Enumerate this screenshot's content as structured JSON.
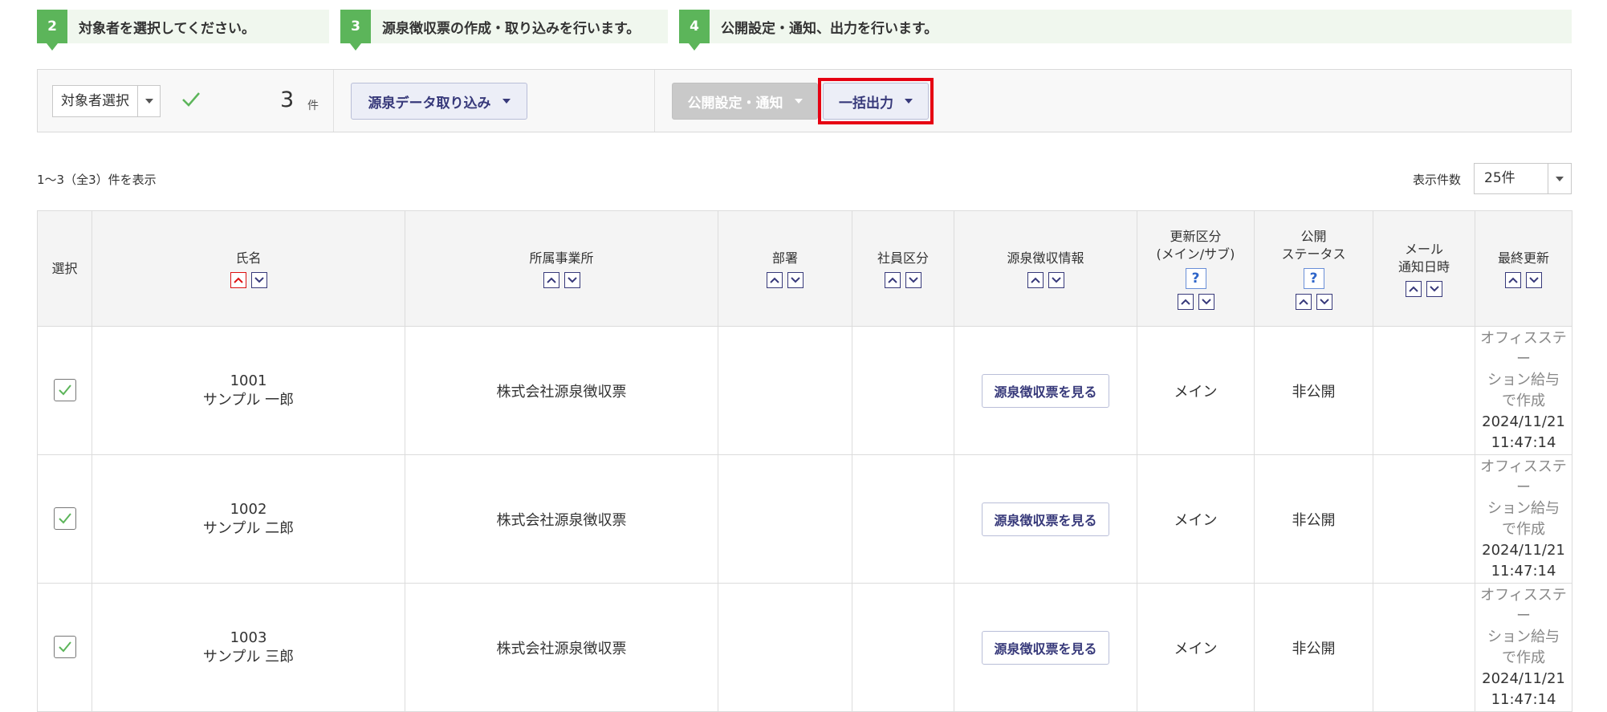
{
  "steps": [
    {
      "num": "2",
      "text": "対象者を選択してください。"
    },
    {
      "num": "3",
      "text": "源泉徴収票の作成・取り込みを行います。"
    },
    {
      "num": "4",
      "text": "公開設定・通知、出力を行います。"
    }
  ],
  "toolbar": {
    "select_label": "対象者選択",
    "count": "3",
    "count_unit": "件",
    "import_label": "源泉データ取り込み",
    "publish_label": "公開設定・通知",
    "bulk_label": "一括出力"
  },
  "info": {
    "range": "1〜3（全3）件を表示",
    "per_page_label": "表示件数",
    "per_page_value": "25件"
  },
  "table": {
    "headers": {
      "select": "選択",
      "name": "氏名",
      "office": "所属事業所",
      "dept": "部署",
      "emp_type": "社員区分",
      "withholding": "源泉徴収情報",
      "update_type_1": "更新区分",
      "update_type_2": "(メイン/サブ)",
      "status_1": "公開",
      "status_2": "ステータス",
      "mail_1": "メール",
      "mail_2": "通知日時",
      "last_update": "最終更新",
      "help": "?"
    },
    "rows": [
      {
        "id": "1001",
        "name": "サンプル 一郎",
        "office": "株式会社源泉徴収票",
        "dept": "",
        "emp_type": "",
        "view": "源泉徴収票を見る",
        "update_type": "メイン",
        "status": "非公開",
        "mail": "",
        "upd_src_1": "オフィスステー",
        "upd_src_2": "ション給与",
        "upd_src_3": "で作成",
        "upd_date": "2024/11/21",
        "upd_time": "11:47:14"
      },
      {
        "id": "1002",
        "name": "サンプル 二郎",
        "office": "株式会社源泉徴収票",
        "dept": "",
        "emp_type": "",
        "view": "源泉徴収票を見る",
        "update_type": "メイン",
        "status": "非公開",
        "mail": "",
        "upd_src_1": "オフィスステー",
        "upd_src_2": "ション給与",
        "upd_src_3": "で作成",
        "upd_date": "2024/11/21",
        "upd_time": "11:47:14"
      },
      {
        "id": "1003",
        "name": "サンプル 三郎",
        "office": "株式会社源泉徴収票",
        "dept": "",
        "emp_type": "",
        "view": "源泉徴収票を見る",
        "update_type": "メイン",
        "status": "非公開",
        "mail": "",
        "upd_src_1": "オフィスステー",
        "upd_src_2": "ション給与",
        "upd_src_3": "で作成",
        "upd_date": "2024/11/21",
        "upd_time": "11:47:14"
      }
    ]
  },
  "colors": {
    "step_green": "#5cb55a",
    "step_bg": "#f0f7ee",
    "accent_navy": "#37397a",
    "highlight_red": "#e60012",
    "check_green": "#5cb55a"
  }
}
